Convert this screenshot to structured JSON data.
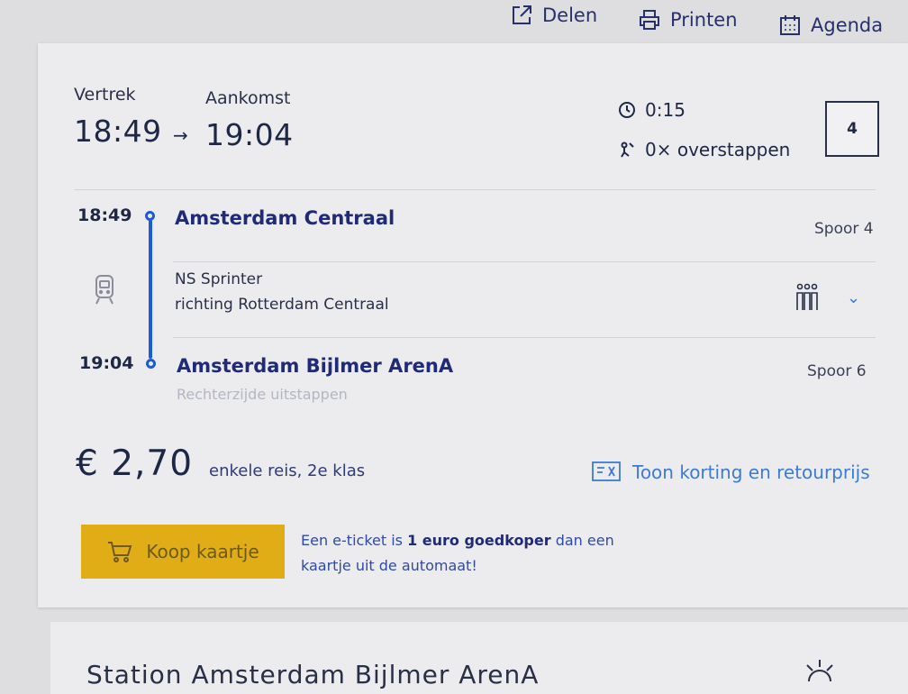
{
  "toolbar": {
    "share_label": "Delen",
    "print_label": "Printen",
    "calendar_label": "Agenda"
  },
  "summary": {
    "departure_label": "Vertrek",
    "departure_time": "18:49",
    "arrival_label": "Aankomst",
    "arrival_time": "19:04",
    "duration": "0:15",
    "transfers": "0× overstappen",
    "platform": "4"
  },
  "stops": [
    {
      "time": "18:49",
      "name": "Amsterdam Centraal",
      "platform": "Spoor 4"
    },
    {
      "time": "19:04",
      "name": "Amsterdam Bijlmer ArenA",
      "platform": "Spoor 6",
      "note": "Rechterzijde uitstappen"
    }
  ],
  "train": {
    "type": "NS Sprinter",
    "direction": "richting Rotterdam Centraal"
  },
  "price": {
    "amount": "€ 2,70",
    "note": "enkele reis, 2e klas",
    "discount_link": "Toon korting en retourprijs"
  },
  "buy": {
    "button_label": "Koop kaartje",
    "eticket_pre": "Een e-ticket is ",
    "eticket_bold": "1 euro goedkoper",
    "eticket_mid": " dan een",
    "eticket_line2": "kaartje uit de automaat!"
  },
  "next_card": {
    "title": "Station Amsterdam Bijlmer ArenA"
  },
  "colors": {
    "accent": "#1e5bd6",
    "buy_button": "#e0ad16",
    "link": "#3b7bd6"
  }
}
